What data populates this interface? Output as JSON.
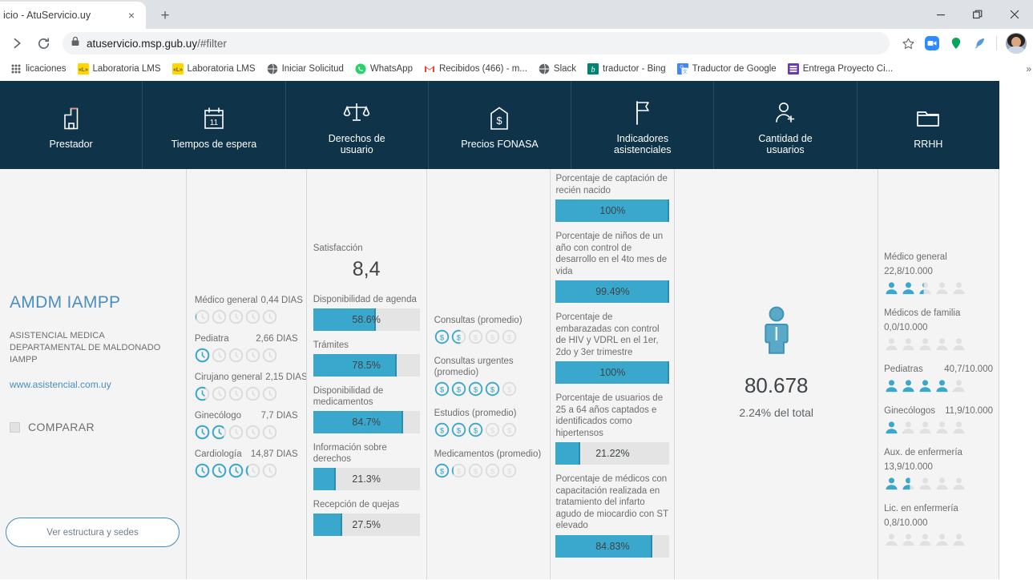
{
  "browser": {
    "tab_title": "icio - AtuServicio.uy",
    "new_tab_label": "+",
    "close_label": "×",
    "url_main": "atuservicio.msp.gub.uy",
    "url_fragment": "/#filter",
    "minimize_label": "—",
    "maximize_label": "❐",
    "close_window_label": "✕",
    "reload_icon": "reload-icon",
    "bookmark_star_icon": "star-icon",
    "bookmarks_overflow": "»",
    "bookmarks": [
      {
        "label": "licaciones",
        "icon": "apps-icon"
      },
      {
        "label": "Laboratoria LMS",
        "icon": "lms-icon"
      },
      {
        "label": "Laboratoria LMS",
        "icon": "lms-icon"
      },
      {
        "label": "Iniciar Solicitud",
        "icon": "globe-icon"
      },
      {
        "label": "WhatsApp",
        "icon": "whatsapp-icon"
      },
      {
        "label": "Recibidos (466) - m...",
        "icon": "gmail-icon"
      },
      {
        "label": "Slack",
        "icon": "slack-globe-icon"
      },
      {
        "label": "traductor - Bing",
        "icon": "bing-icon"
      },
      {
        "label": "Traductor de Google",
        "icon": "google-translate-icon"
      },
      {
        "label": "Entrega Proyecto Ci...",
        "icon": "sheets-icon"
      }
    ]
  },
  "colors": {
    "nav_background": "#0f3349",
    "accent": "#3aa8cc",
    "accent_dark": "#2b8cb0",
    "link": "#4a8ec2",
    "content_background": "#f4f4f4",
    "track": "#e4e4e4"
  },
  "nav": {
    "items": [
      {
        "label": "Prestador",
        "icon": "hospital-building-icon"
      },
      {
        "label": "Tiempos de espera",
        "icon": "calendar-11-icon"
      },
      {
        "label": "Derechos de usuario",
        "icon": "scales-balance-icon"
      },
      {
        "label": "Precios FONASA",
        "icon": "price-tag-dollar-icon"
      },
      {
        "label": "Indicadores asistenciales",
        "icon": "flag-icon"
      },
      {
        "label": "Cantidad de usuarios",
        "icon": "user-plus-icon"
      },
      {
        "label": "RRHH",
        "icon": "folder-icon"
      }
    ]
  },
  "prestador": {
    "name": "AMDM IAMPP",
    "description": "ASISTENCIAL MEDICA DEPARTAMENTAL DE MALDONADO IAMPP",
    "url": "www.asistencial.com.uy",
    "compare_label": "COMPARAR",
    "compare_checked": false,
    "structure_button": "Ver estructura y sedes"
  },
  "tiempos_espera": {
    "items": [
      {
        "name": "Médico general",
        "value": "0,44 DIAS",
        "filled": 0.1,
        "total": 5
      },
      {
        "name": "Pediatra",
        "value": "2,66 DIAS",
        "filled": 1.0,
        "total": 5
      },
      {
        "name": "Cirujano general",
        "value": "2,15 DIAS",
        "filled": 0.7,
        "total": 5
      },
      {
        "name": "Ginecólogo",
        "value": "7,7 DIAS",
        "filled": 1.8,
        "total": 5
      },
      {
        "name": "Cardiología",
        "value": "14,87 DIAS",
        "filled": 3.2,
        "total": 5
      }
    ]
  },
  "derechos_usuario": {
    "satisfaction_label": "Satisfacción",
    "satisfaction_value": "8,4",
    "bars": [
      {
        "label": "Disponibilidad de agenda",
        "value": "58.6%",
        "pct": 58.6
      },
      {
        "label": "Trámites",
        "value": "78.5%",
        "pct": 78.5
      },
      {
        "label": "Disponibilidad de medicamentos",
        "value": "84.7%",
        "pct": 84.7
      },
      {
        "label": "Información sobre derechos",
        "value": "21.3%",
        "pct": 21.3
      },
      {
        "label": "Recepción de quejas",
        "value": "27.5%",
        "pct": 27.5
      }
    ]
  },
  "precios_fonasa": {
    "items": [
      {
        "name": "Consultas (promedio)",
        "filled": 1.6,
        "total": 5
      },
      {
        "name": "Consultas urgentes (promedio)",
        "filled": 4.0,
        "total": 5
      },
      {
        "name": "Estudios (promedio)",
        "filled": 3.0,
        "total": 5
      },
      {
        "name": "Medicamentos (promedio)",
        "filled": 1.15,
        "total": 5
      }
    ]
  },
  "indicadores_asistenciales": {
    "bars": [
      {
        "label": "Porcentaje de captación de recién nacido",
        "value": "100%",
        "pct": 100
      },
      {
        "label": "Porcentaje de niños de un año con control de desarrollo en el 4to mes de vida",
        "value": "99.49%",
        "pct": 99.49
      },
      {
        "label": "Porcentaje de embarazadas con control de HIV y VDRL en el 1er, 2do y 3er trimestre",
        "value": "100%",
        "pct": 100
      },
      {
        "label": "Porcentaje de usuarios de 25 a 64 años captados e identificados como hipertensos",
        "value": "21.22%",
        "pct": 21.22
      },
      {
        "label": "Porcentaje de médicos con capacitación realizada en tratamiento del infarto agudo de miocardio con ST elevado",
        "value": "84.83%",
        "pct": 84.83
      }
    ]
  },
  "cantidad_usuarios": {
    "icon": "person-icon",
    "count": "80.678",
    "subtitle": "2.24% del total"
  },
  "rrhh": {
    "items": [
      {
        "name": "Médico general",
        "value": "22,8/10.000",
        "filled": 2.4,
        "total": 5
      },
      {
        "name": "Médicos de familia",
        "value": "0,0/10.000",
        "filled": 0.05,
        "total": 5
      },
      {
        "name": "Pediatras",
        "value": "40,7/10.000",
        "filled": 4.15,
        "total": 5
      },
      {
        "name": "Ginecólogos",
        "value": "11,9/10.000",
        "filled": 1.15,
        "total": 5
      },
      {
        "name": "Aux. de enfermería",
        "value": "13,9/10.000",
        "filled": 1.6,
        "total": 5
      },
      {
        "name": "Lic. en enfermería",
        "value": "0,8/10.000",
        "filled": 0.06,
        "total": 5
      }
    ]
  }
}
